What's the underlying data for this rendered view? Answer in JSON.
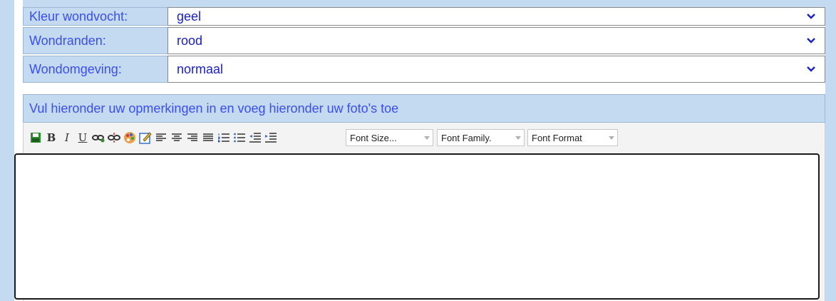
{
  "form": {
    "rows": [
      {
        "label": "Kleur wondvocht:",
        "value": "geel"
      },
      {
        "label": "Wondranden:",
        "value": "rood"
      },
      {
        "label": "Wondomgeving:",
        "value": "normaal"
      }
    ],
    "notice": "Vul hieronder uw opmerkingen in en voeg hieronder uw foto's toe"
  },
  "toolbar": {
    "buttons": [
      {
        "icon": "save-icon"
      },
      {
        "icon": "bold-icon",
        "text": "B"
      },
      {
        "icon": "italic-icon",
        "text": "I"
      },
      {
        "icon": "underline-icon",
        "text": "U"
      },
      {
        "icon": "link-icon"
      },
      {
        "icon": "unlink-icon"
      },
      {
        "icon": "color-palette-icon"
      },
      {
        "icon": "edit-icon"
      },
      {
        "icon": "align-left-icon"
      },
      {
        "icon": "align-center-icon"
      },
      {
        "icon": "align-right-icon"
      },
      {
        "icon": "align-justify-icon"
      },
      {
        "icon": "numbered-list-icon"
      },
      {
        "icon": "bullet-list-icon"
      },
      {
        "icon": "outdent-icon"
      },
      {
        "icon": "indent-icon"
      }
    ],
    "font_size": "Font Size...",
    "font_family": "Font Family.",
    "font_format": "Font Format"
  },
  "colors": {
    "label_bg": "#c4daf0",
    "label_text": "#3a4ff0",
    "value_text": "#1a22c8"
  }
}
